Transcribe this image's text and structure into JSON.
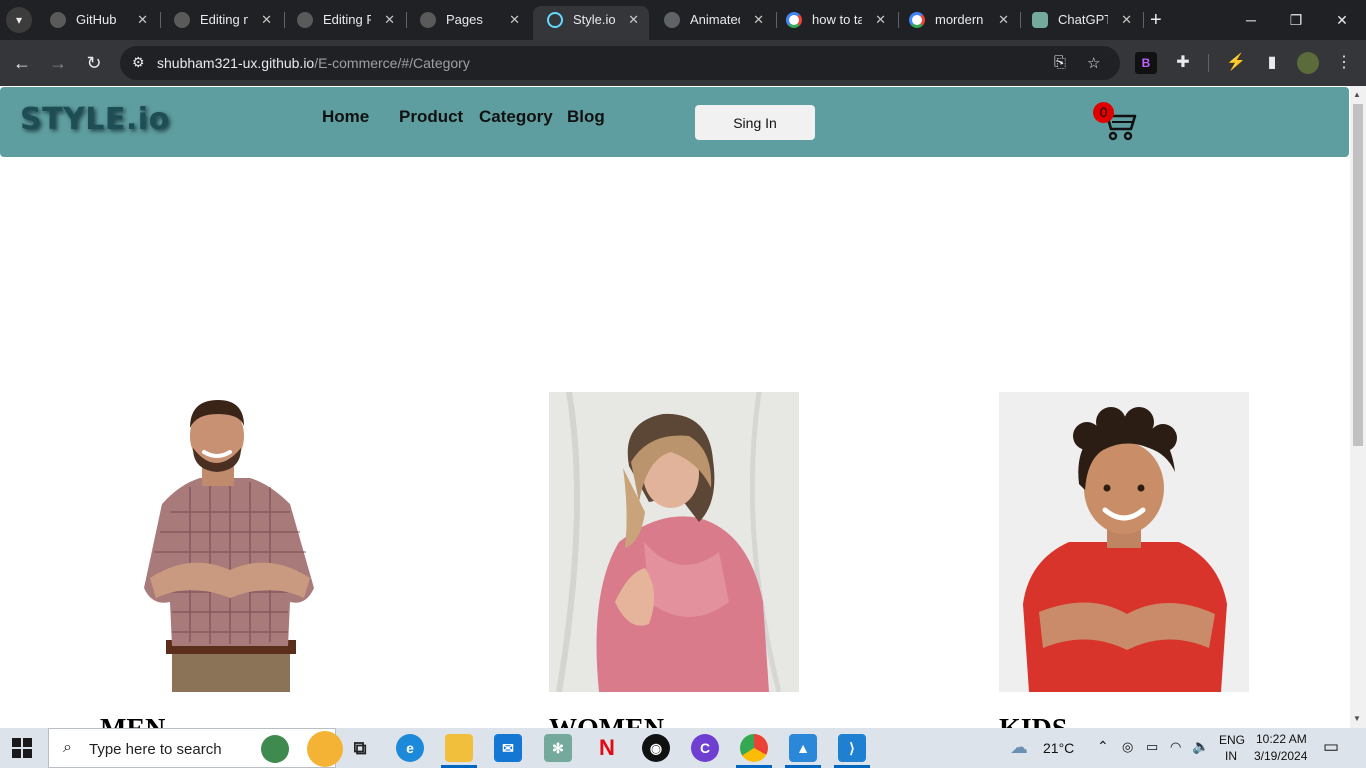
{
  "browser": {
    "tabs": [
      {
        "label": "GitHub",
        "icon": "github-icon",
        "active": false
      },
      {
        "label": "Editing m",
        "icon": "github-icon",
        "active": false
      },
      {
        "label": "Editing Po",
        "icon": "github-icon",
        "active": false
      },
      {
        "label": "Pages",
        "icon": "github-icon",
        "active": false
      },
      {
        "label": "Style.io",
        "icon": "react-icon",
        "active": true
      },
      {
        "label": "Animated",
        "icon": "animated-icon",
        "active": false
      },
      {
        "label": "how to ta",
        "icon": "google-icon",
        "active": false
      },
      {
        "label": "mordern s",
        "icon": "google-icon",
        "active": false
      },
      {
        "label": "ChatGPT",
        "icon": "chatgpt-icon",
        "active": false
      }
    ],
    "url_host": "shubham321-ux.github.io",
    "url_path": "/E-commerce/#/Category"
  },
  "site": {
    "logo": "STYLE.io",
    "nav": {
      "home": "Home",
      "product": "Product",
      "category": "Category",
      "blog": "Blog"
    },
    "signin_label": "Sing In",
    "cart_count": "0"
  },
  "categories": [
    {
      "title": "MEN"
    },
    {
      "title": "WOMEN"
    },
    {
      "title": "KIDS"
    }
  ],
  "taskbar": {
    "search_placeholder": "Type here to search",
    "weather": "21°C",
    "language_top": "ENG",
    "language_bottom": "IN",
    "time": "10:22 AM",
    "date": "3/19/2024"
  },
  "colors": {
    "navbar": "#5f9ea0",
    "logo": "#1d4d55",
    "cart_badge": "#e00000"
  }
}
